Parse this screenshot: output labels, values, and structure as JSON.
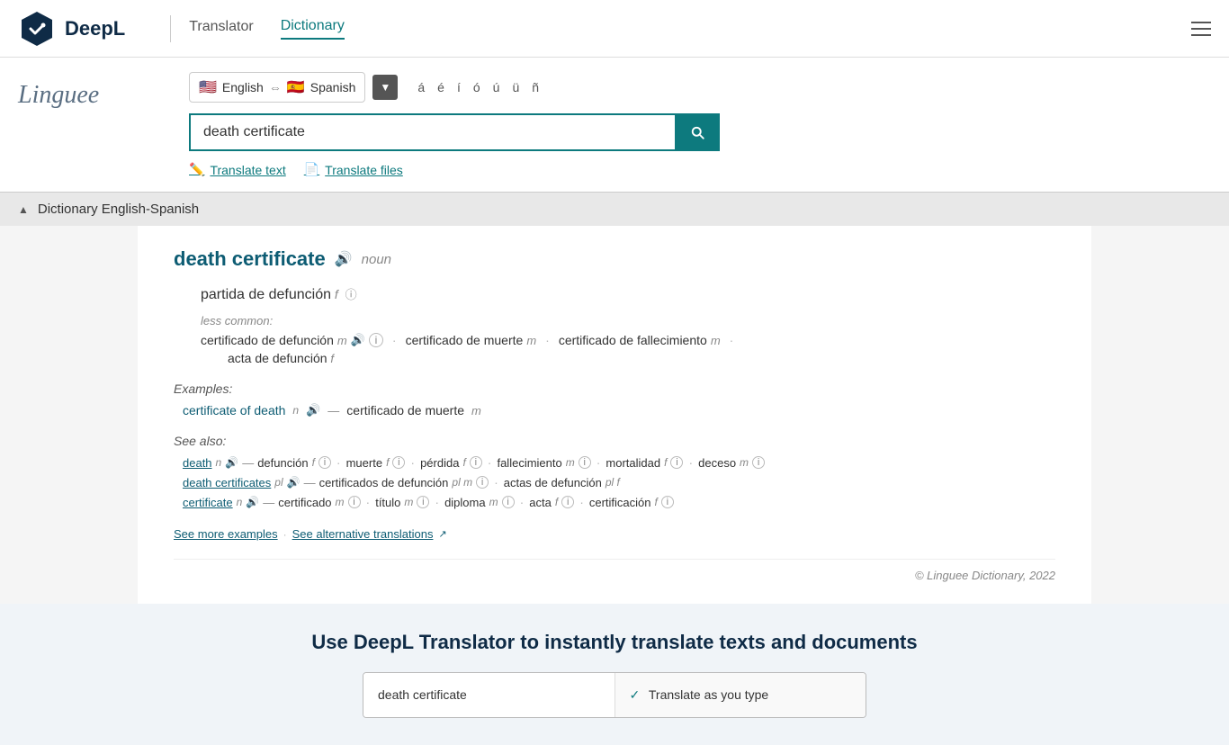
{
  "header": {
    "logo_text": "DeepL",
    "nav": {
      "translator": "Translator",
      "dictionary": "Dictionary"
    }
  },
  "search": {
    "lang_from": "English",
    "lang_to": "Spanish",
    "flag_from": "🇺🇸",
    "flag_to": "🇪🇸",
    "query": "death certificate",
    "special_chars": [
      "á",
      "é",
      "í",
      "ó",
      "ú",
      "ü",
      "ñ"
    ],
    "translate_text_label": "Translate text",
    "translate_files_label": "Translate files"
  },
  "dictionary": {
    "header": "Dictionary English-Spanish",
    "entry": {
      "word": "death certificate",
      "pos": "noun",
      "primary_translation": "partida de defunción",
      "primary_gender": "f",
      "less_common_label": "less common:",
      "less_common": [
        {
          "text": "certificado de defunción",
          "gender": "m"
        },
        {
          "text": "certificado de muerte",
          "gender": "m"
        },
        {
          "text": "certificado de fallecimiento",
          "gender": "m"
        }
      ],
      "less_common_extra": "acta de defunción",
      "less_common_extra_gender": "f"
    },
    "examples_label": "Examples:",
    "examples": [
      {
        "en": "certificate of death",
        "pos": "n",
        "es": "certificado de muerte",
        "es_gender": "m"
      }
    ],
    "see_also_label": "See also:",
    "see_also_rows": [
      {
        "items": [
          {
            "term": "death",
            "pos": "n",
            "has_audio": true,
            "dash": "—",
            "translations": [
              {
                "word": "defunción",
                "gender": "f",
                "has_info": true
              },
              {
                "word": "muerte",
                "gender": "f",
                "has_info": true
              },
              {
                "word": "pérdida",
                "gender": "f",
                "has_info": true
              },
              {
                "word": "fallecimiento",
                "gender": "m",
                "has_info": true
              },
              {
                "word": "mortalidad",
                "gender": "f",
                "has_info": true
              },
              {
                "word": "deceso",
                "gender": "m",
                "has_info": true
              }
            ]
          }
        ]
      },
      {
        "items": [
          {
            "term": "death certificates",
            "pos": "pl",
            "has_audio": true,
            "dash": "—",
            "translations": [
              {
                "word": "certificados de defunción",
                "gender": "pl m",
                "has_info": true
              },
              {
                "word": "actas de defunción",
                "gender": "pl f",
                "has_info": false
              }
            ]
          }
        ]
      },
      {
        "items": [
          {
            "term": "certificate",
            "pos": "n",
            "has_audio": true,
            "dash": "—",
            "translations": [
              {
                "word": "certificado",
                "gender": "m",
                "has_info": true
              },
              {
                "word": "título",
                "gender": "m",
                "has_info": true
              },
              {
                "word": "diploma",
                "gender": "m",
                "has_info": true
              },
              {
                "word": "acta",
                "gender": "f",
                "has_info": true
              },
              {
                "word": "certificación",
                "gender": "f",
                "has_info": true
              }
            ]
          }
        ]
      }
    ],
    "footer_links": {
      "more_examples": "See more examples",
      "alt_translations": "See alternative translations"
    },
    "copyright": "© Linguee Dictionary, 2022"
  },
  "promo": {
    "title": "Use DeepL Translator to instantly translate texts and documents",
    "box_left_text": "death certificate",
    "box_right_check": "✓",
    "box_right_text": "Translate as you type"
  }
}
